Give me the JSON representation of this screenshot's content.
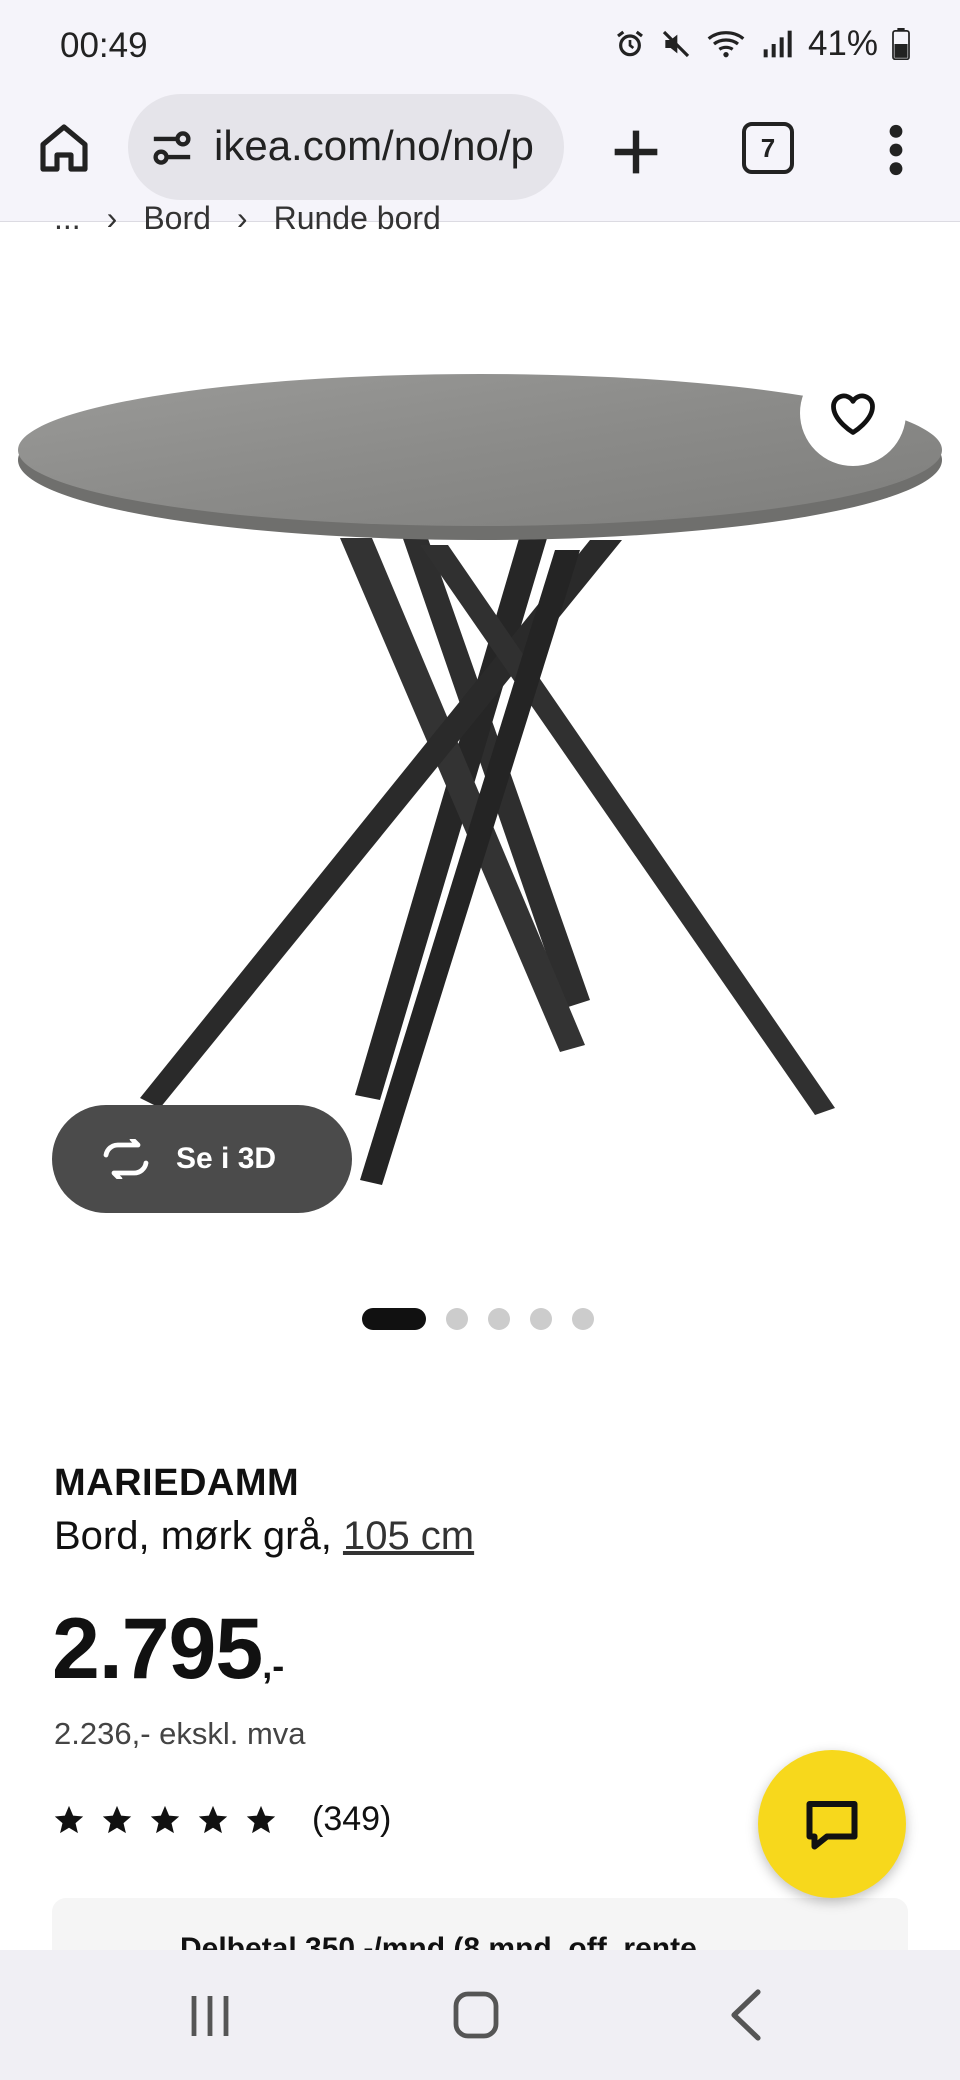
{
  "status_bar": {
    "time": "00:49",
    "battery": "41%",
    "icons": [
      "alarm-icon",
      "mute-icon",
      "wifi-icon",
      "signal-icon",
      "battery-icon"
    ]
  },
  "browser": {
    "url": "ikea.com/no/no/p",
    "tab_count": "7",
    "icons": [
      "home-icon",
      "site-settings-icon",
      "new-tab-icon",
      "tabs-icon",
      "more-menu-icon"
    ]
  },
  "breadcrumb": {
    "items": [
      "...",
      "Bord",
      "Runde bord"
    ]
  },
  "product": {
    "see_3d_label": "Se i 3D",
    "name": "MARIEDAMM",
    "description_prefix": "Bord, mørk grå, ",
    "size_link": "105 cm",
    "price_integer": "2.795",
    "price_suffix": ",-",
    "price_ex_vat": "2.236,- ekskl. mva",
    "rating_value": 5,
    "rating_count": "(349)",
    "carousel_count": 5,
    "carousel_active": 1
  },
  "promo": {
    "text": "Delbetal 350,-/mnd (8 mnd. off. rente"
  },
  "colors": {
    "chat_button": "#f7d81c",
    "see3d_button": "#4b4b4b",
    "tabletop": "#8e8e8c",
    "legs": "#2b2b2b"
  }
}
